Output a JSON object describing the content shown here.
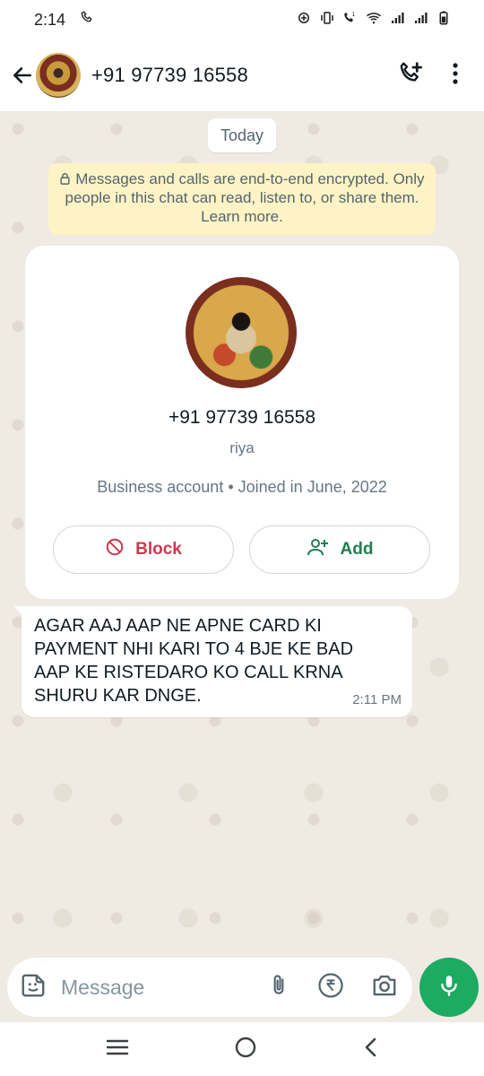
{
  "status_bar": {
    "time": "2:14",
    "icons": [
      "wifi-call-icon",
      "data-saver-icon",
      "vibrate-icon",
      "volte-icon",
      "wifi-icon",
      "signal-icon",
      "signal-icon",
      "battery-icon"
    ]
  },
  "header": {
    "contact": "+91 97739 16558",
    "icons": [
      "back-arrow-icon",
      "add-call-icon",
      "more-vert-icon"
    ]
  },
  "chat": {
    "date_chip": "Today",
    "encryption_notice": "Messages and calls are end-to-end encrypted. Only people in this chat can read, listen to, or share them. Learn more.",
    "profile_card": {
      "number": "+91 97739 16558",
      "name": "riya",
      "info": "Business account • Joined in June, 2022",
      "block_label": "Block",
      "add_label": "Add"
    },
    "messages": [
      {
        "text": "AGAR AAJ AAP NE APNE CARD KI PAYMENT NHI KARI TO 4 BJE KE BAD AAP KE RISTEDARO KO CALL KRNA SHURU KAR DNGE.",
        "time": "2:11 PM"
      }
    ]
  },
  "composer": {
    "placeholder": "Message",
    "icons": [
      "sticker-icon",
      "attach-icon",
      "rupee-payment-icon",
      "camera-icon",
      "mic-icon"
    ]
  },
  "nav_bar": {
    "icons": [
      "recents-icon",
      "home-icon",
      "back-icon"
    ]
  },
  "colors": {
    "accent_green": "#1daa61",
    "block_red": "#d1364f",
    "add_green": "#1f7f4f",
    "encryption_bg": "#fdf3c5",
    "chat_bg": "#efeae2"
  }
}
